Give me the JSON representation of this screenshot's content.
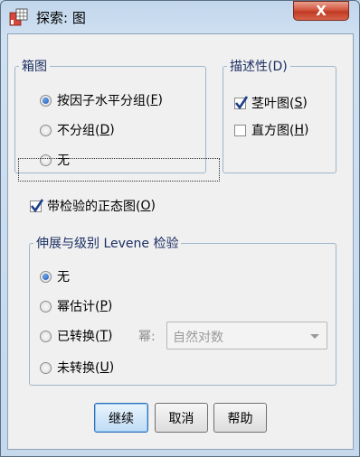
{
  "window": {
    "title": "探索: 图",
    "close_label": "X"
  },
  "boxplot": {
    "legend": "箱图",
    "options": [
      {
        "label": "按因子水平分组(",
        "key": "F",
        "tail": ")",
        "selected": true
      },
      {
        "label": "不分组(",
        "key": "D",
        "tail": ")",
        "selected": false
      },
      {
        "label": "无",
        "key": "",
        "tail": "",
        "selected": false
      }
    ]
  },
  "descriptive": {
    "legend": "描述性(D)",
    "options": [
      {
        "label": "茎叶图(",
        "key": "S",
        "tail": ")",
        "checked": true
      },
      {
        "label": "直方图(",
        "key": "H",
        "tail": ")",
        "checked": false
      }
    ]
  },
  "normality": {
    "label": "带检验的正态图(",
    "key": "O",
    "tail": ")",
    "checked": true
  },
  "levene": {
    "legend": "伸展与级别 Levene 检验",
    "options": [
      {
        "label": "无",
        "key": "",
        "tail": "",
        "selected": true
      },
      {
        "label": "幂估计(",
        "key": "P",
        "tail": ")",
        "selected": false
      },
      {
        "label": "已转换(",
        "key": "T",
        "tail": ")",
        "selected": false
      },
      {
        "label": "未转换(",
        "key": "U",
        "tail": ")",
        "selected": false
      }
    ],
    "power_label": "幂:",
    "power_value": "自然对数"
  },
  "buttons": {
    "continue": "继续",
    "cancel": "取消",
    "help": "帮助"
  },
  "colors": {
    "legend": "#1b2f63",
    "accent": "#1e5ab8",
    "close": "#c13a24"
  }
}
